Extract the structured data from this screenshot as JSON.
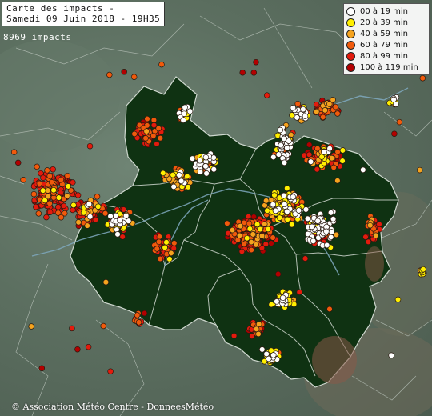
{
  "title": {
    "line1": "Carte des impacts -",
    "line2": "Samedi 09 Juin 2018 - 19H35"
  },
  "impacts_count": "8969 impacts",
  "legend": [
    {
      "label": "00 à 19 min",
      "color": "#ffffff"
    },
    {
      "label": "20 à 39 min",
      "color": "#ffef00"
    },
    {
      "label": "40 à 59 min",
      "color": "#f5a31e"
    },
    {
      "label": "60 à 79 min",
      "color": "#f05a0c"
    },
    {
      "label": "80 à 99 min",
      "color": "#e31b0d"
    },
    {
      "label": "100 à 119 min",
      "color": "#b30000"
    }
  ],
  "copyright": "© Association Météo Centre - DonneesMétéo",
  "colors": {
    "region_fill": "#0f3212",
    "region_border": "#cfd8cf",
    "outside_land": "#5e7262",
    "rivers": "#7fa9bf",
    "relief": "#8b5a48"
  }
}
